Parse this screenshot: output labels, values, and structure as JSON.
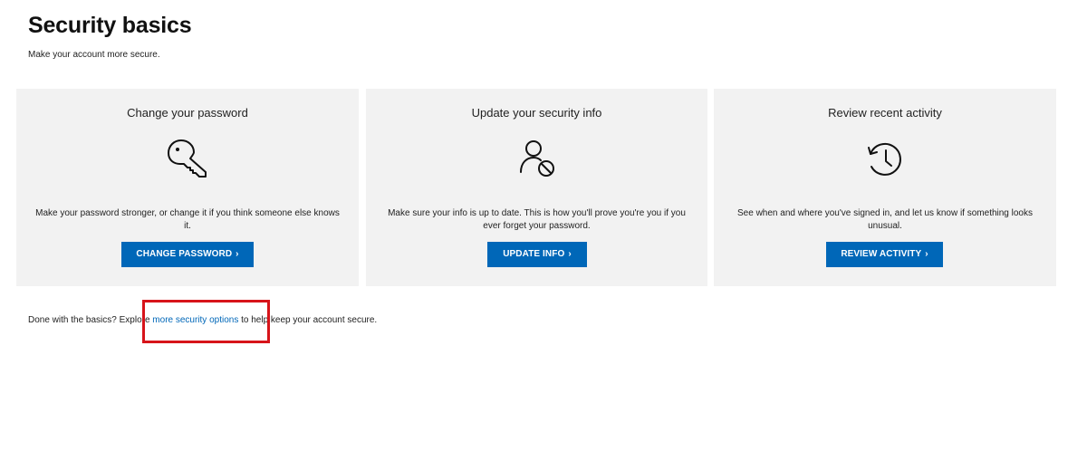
{
  "header": {
    "title": "Security basics",
    "subtitle": "Make your account more secure."
  },
  "cards": [
    {
      "title": "Change your password",
      "icon": "key-icon",
      "description": "Make your password stronger, or change it if you think someone else knows it.",
      "button_label": "CHANGE PASSWORD"
    },
    {
      "title": "Update your security info",
      "icon": "user-blocked-icon",
      "description": "Make sure your info is up to date. This is how you'll prove you're you if you ever forget your password.",
      "button_label": "UPDATE INFO"
    },
    {
      "title": "Review recent activity",
      "icon": "history-icon",
      "description": "See when and where you've signed in, and let us know if something looks unusual.",
      "button_label": "REVIEW ACTIVITY"
    }
  ],
  "footer": {
    "prefix": "Done with the basics? Explore ",
    "link_label": "more security options",
    "suffix": " to help keep your account secure."
  },
  "colors": {
    "accent": "#0067b8",
    "card_background": "#f2f2f2",
    "highlight": "#d7141a"
  }
}
